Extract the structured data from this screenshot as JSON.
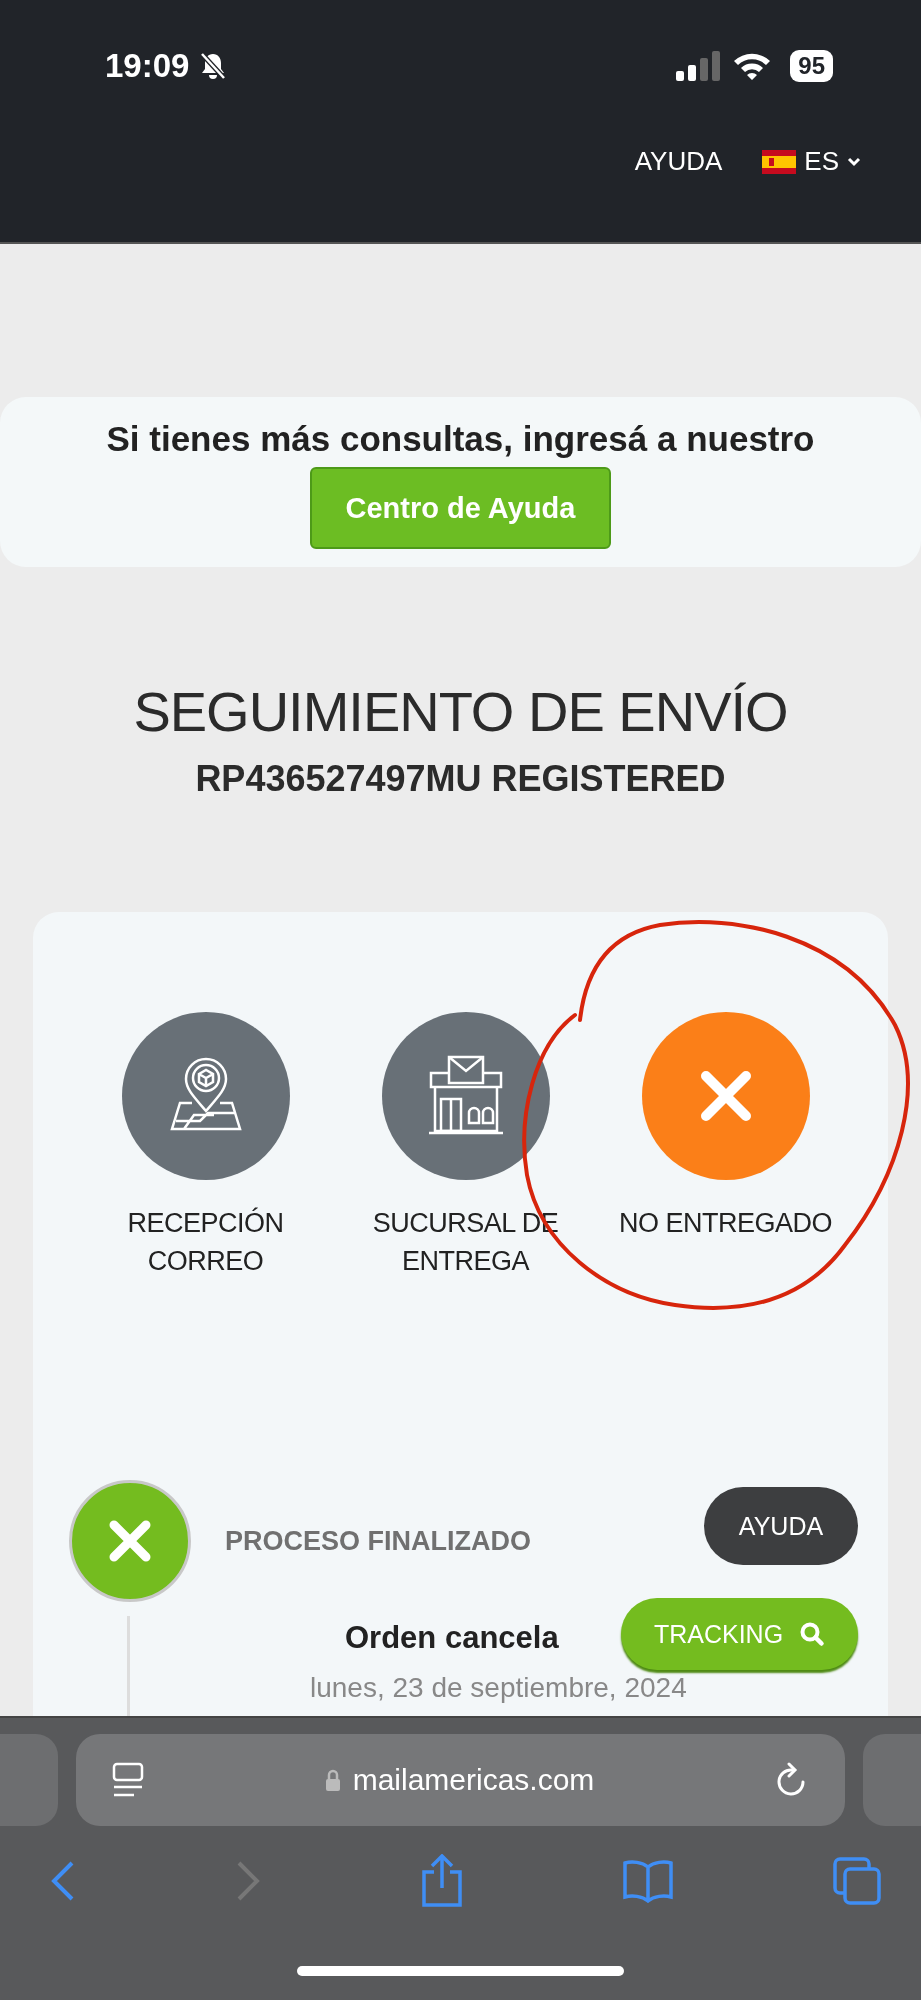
{
  "status_bar": {
    "time": "19:09",
    "battery": "95"
  },
  "header": {
    "help_link": "AYUDA",
    "language": "ES"
  },
  "help_banner": {
    "text": "Si tienes más consultas, ingresá a nuestro",
    "button": "Centro de Ayuda"
  },
  "tracking": {
    "title": "SEGUIMIENTO DE ENVÍO",
    "number": "RP436527497MU REGISTERED"
  },
  "steps": [
    {
      "kind": "pin",
      "label": "RECEPCIÓN CORREO",
      "color": "#687077"
    },
    {
      "kind": "branch",
      "label": "SUCURSAL DE ENTREGA",
      "color": "#687077"
    },
    {
      "kind": "failed",
      "label": "NO ENTREGADO",
      "color": "#fb7f18"
    }
  ],
  "timeline": {
    "status": "PROCESO FINALIZADO",
    "event": "Orden cancela",
    "date": "lunes, 23 de septiembre, 2024"
  },
  "floating": {
    "help": "AYUDA",
    "tracking": "TRACKING"
  },
  "browser": {
    "url": "mailamericas.com",
    "back_enabled": true,
    "forward_enabled": false
  }
}
